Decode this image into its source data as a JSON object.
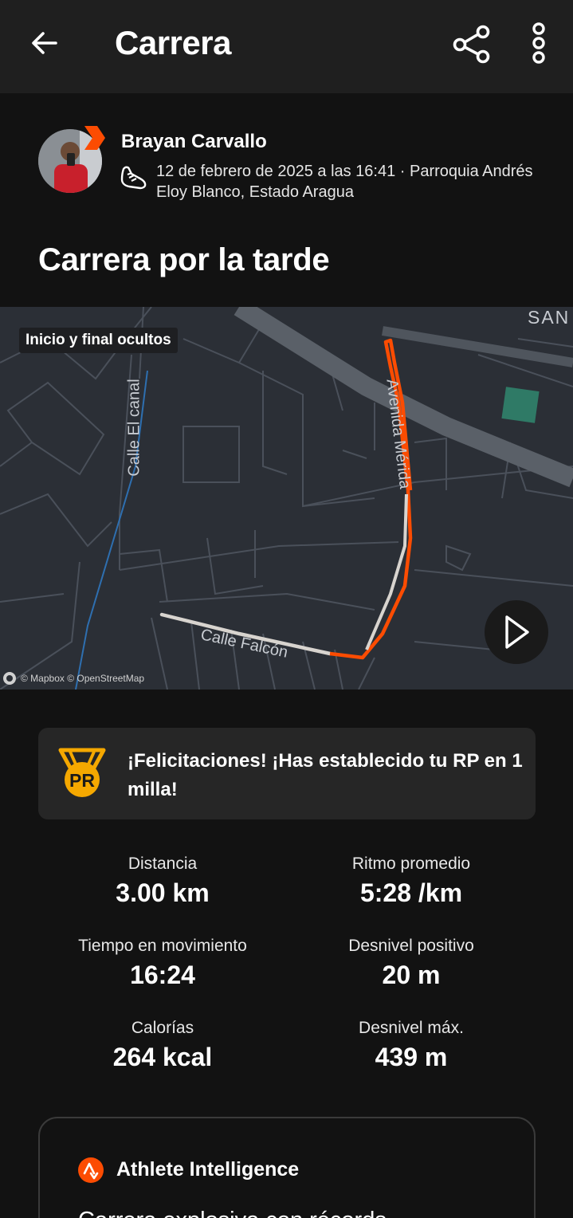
{
  "header": {
    "title": "Carrera",
    "icons": {
      "back": "arrow-left-icon",
      "share": "share-icon",
      "more": "more-vertical-icon"
    }
  },
  "athlete": {
    "name": "Brayan Carvallo",
    "date_location": "12 de febrero de 2025 a las 16:41 · Parroquia Andrés Eloy Blanco, Estado Aragua",
    "subscriber_color": "#fc4c02"
  },
  "activity": {
    "title": "Carrera por la tarde"
  },
  "map": {
    "privacy_chip": "Inicio y final ocultos",
    "attribution": "© Mapbox © OpenStreetMap",
    "street_labels": {
      "calle_el_canal": "Calle El canal",
      "avenida_merida": "Avenida Mérida",
      "calle_falcon": "Calle Falcón",
      "corner": "SAN"
    },
    "route_color": "#fc4c02",
    "hidden_route_color": "#d8d4cf"
  },
  "pr_banner": {
    "text": "¡Felicitaciones! ¡Has establecido tu RP en 1 milla!",
    "badge_text": "PR",
    "badge_color": "#f5a800"
  },
  "stats": [
    {
      "label": "Distancia",
      "value": "3.00 km"
    },
    {
      "label": "Ritmo promedio",
      "value": "5:28 /km"
    },
    {
      "label": "Tiempo en movimiento",
      "value": "16:24"
    },
    {
      "label": "Desnivel positivo",
      "value": "20 m"
    },
    {
      "label": "Calorías",
      "value": "264 kcal"
    },
    {
      "label": "Desnivel máx.",
      "value": "439 m"
    }
  ],
  "athlete_intelligence": {
    "title": "Athlete Intelligence",
    "body": "Carrera explosiva con récords"
  }
}
